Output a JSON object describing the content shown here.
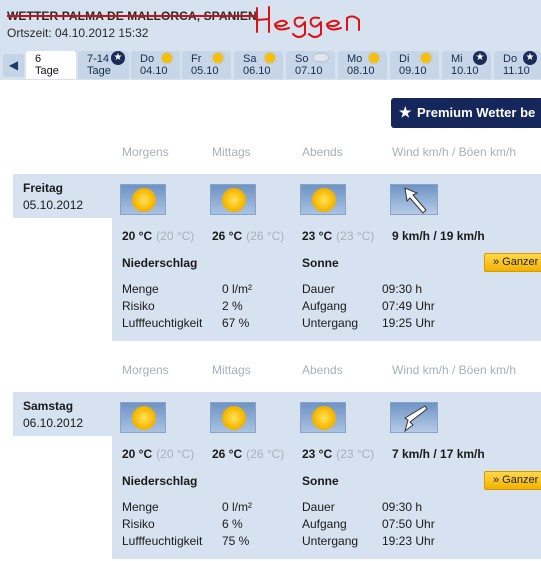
{
  "header": {
    "title": "WETTER PALMA DE MALLORCA, SPANIEN",
    "local_time": "Ortszeit: 04.10.2012 15:32",
    "scribble": "Heggen"
  },
  "tabs": [
    {
      "top": "6",
      "bottom": "Tage",
      "active": true,
      "icon": "none"
    },
    {
      "top": "7-14",
      "bottom": "Tage",
      "icon": "premium-star-icon"
    },
    {
      "top": "Do",
      "bottom": "04.10",
      "icon": "sun-icon"
    },
    {
      "top": "Fr",
      "bottom": "05.10",
      "icon": "sun-icon"
    },
    {
      "top": "Sa",
      "bottom": "06.10",
      "icon": "sun-icon"
    },
    {
      "top": "So",
      "bottom": "07.10",
      "icon": "cloud-icon"
    },
    {
      "top": "Mo",
      "bottom": "08.10",
      "icon": "sun-icon"
    },
    {
      "top": "Di",
      "bottom": "09.10",
      "icon": "sun-icon"
    },
    {
      "top": "Mi",
      "bottom": "10.10",
      "icon": "premium-star-icon"
    },
    {
      "top": "Do",
      "bottom": "11.10",
      "icon": "premium-star-icon"
    }
  ],
  "premium": {
    "label": "Premium Wetter be"
  },
  "columns": {
    "morning": "Morgens",
    "noon": "Mittags",
    "evening": "Abends",
    "wind": "Wind km/h / Böen km/h"
  },
  "sections": {
    "precip": "Niederschlag",
    "sun": "Sonne",
    "amount": "Menge",
    "risk": "Risiko",
    "humidity": "Lufffeuchtigkeit",
    "duration": "Dauer",
    "rise": "Aufgang",
    "set": "Untergang",
    "full_button": "» Ganzer"
  },
  "days": [
    {
      "name": "Freitag",
      "date": "05.10.2012",
      "morning_temp": "20 °C",
      "morning_feel": "(20 °C)",
      "noon_temp": "26 °C",
      "noon_feel": "(26 °C)",
      "evening_temp": "23 °C",
      "evening_feel": "(23 °C)",
      "wind": "9 km/h / 19 km/h",
      "wind_direction": "from-northwest",
      "amount": "0 l/m²",
      "risk": "2 %",
      "humidity": "67 %",
      "sun_duration": "09:30 h",
      "sunrise": "07:49 Uhr",
      "sunset": "19:25 Uhr"
    },
    {
      "name": "Samstag",
      "date": "06.10.2012",
      "morning_temp": "20 °C",
      "morning_feel": "(20 °C)",
      "noon_temp": "26 °C",
      "noon_feel": "(26 °C)",
      "evening_temp": "23 °C",
      "evening_feel": "(23 °C)",
      "wind": "7 km/h / 17 km/h",
      "wind_direction": "from-southwest",
      "amount": "0 l/m²",
      "risk": "6 %",
      "humidity": "75 %",
      "sun_duration": "09:30 h",
      "sunrise": "07:50 Uhr",
      "sunset": "19:23 Uhr"
    }
  ],
  "colors": {
    "header_bg": "#d6e2f0",
    "premium_bg": "#14265a",
    "button_yellow": "#f3b100",
    "scribble_red": "#e01010"
  }
}
